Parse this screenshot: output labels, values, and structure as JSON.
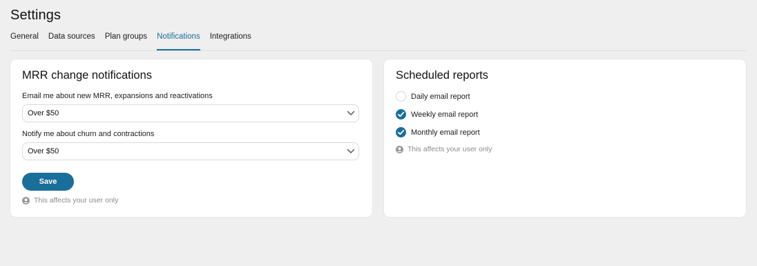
{
  "page": {
    "title": "Settings"
  },
  "tabs": [
    {
      "label": "General",
      "active": false
    },
    {
      "label": "Data sources",
      "active": false
    },
    {
      "label": "Plan groups",
      "active": false
    },
    {
      "label": "Notifications",
      "active": true
    },
    {
      "label": "Integrations",
      "active": false
    }
  ],
  "colors": {
    "accent": "#1a6e9a",
    "background": "#efefef",
    "card": "#ffffff",
    "muted_text": "#8a8a8a"
  },
  "mrr_card": {
    "title": "MRR change notifications",
    "new_mrr": {
      "label": "Email me about new MRR, expansions and reactivations",
      "value": "Over $50"
    },
    "churn": {
      "label": "Notify me about churn and contractions",
      "value": "Over $50"
    },
    "save_label": "Save",
    "note": "This affects your user only"
  },
  "reports_card": {
    "title": "Scheduled reports",
    "items": [
      {
        "label": "Daily email report",
        "checked": false
      },
      {
        "label": "Weekly email report",
        "checked": true
      },
      {
        "label": "Monthly email report",
        "checked": true
      }
    ],
    "note": "This affects your user only"
  }
}
